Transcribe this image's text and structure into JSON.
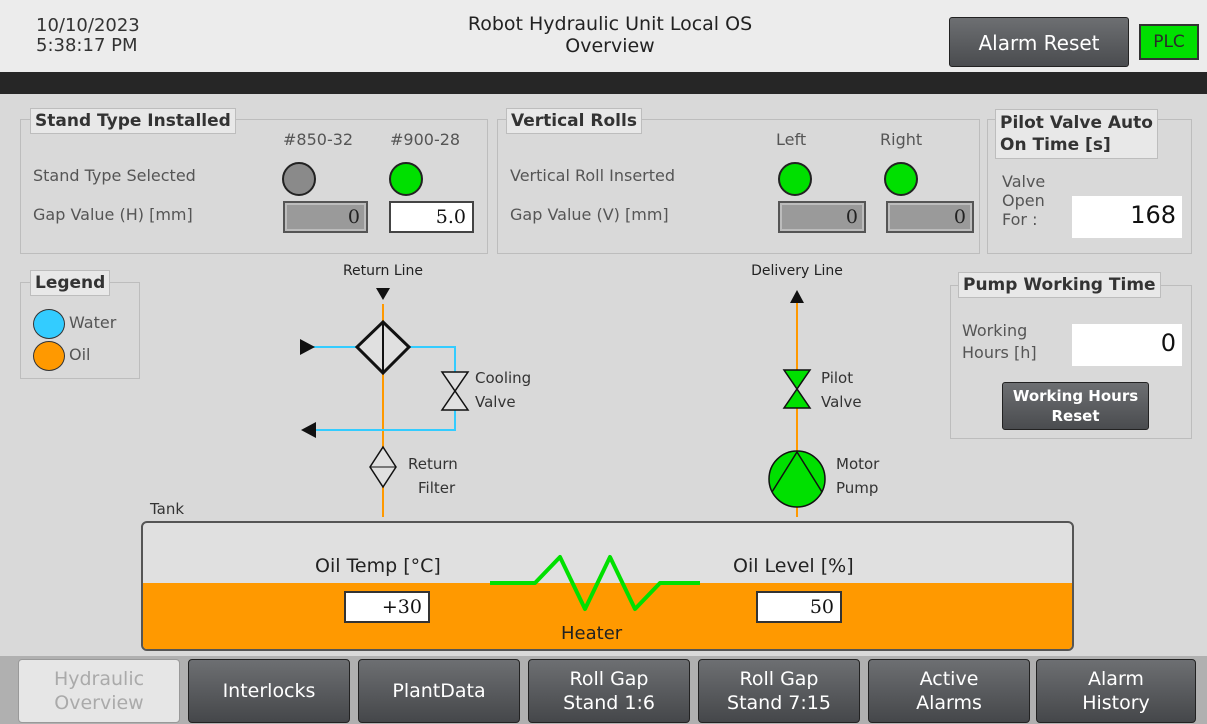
{
  "header": {
    "date": "10/10/2023",
    "time": "5:38:17 PM",
    "title_line1": "Robot Hydraulic Unit Local OS",
    "title_line2": "Overview",
    "alarm_reset_label": "Alarm Reset",
    "plc_label": "PLC"
  },
  "stand_type": {
    "title": "Stand Type Installed",
    "col1": "#850-32",
    "col2": "#900-28",
    "row1_label": "Stand Type Selected",
    "row2_label": "Gap Value (H) [mm]",
    "gap1_value": "0",
    "gap2_value": "5.0"
  },
  "vertical_rolls": {
    "title": "Vertical Rolls",
    "col1": "Left",
    "col2": "Right",
    "row1_label": "Vertical Roll Inserted",
    "row2_label": "Gap Value (V) [mm]",
    "gap1_value": "0",
    "gap2_value": "0"
  },
  "pilot_valve": {
    "title_line1": "Pilot Valve Auto",
    "title_line2": "On Time [s]",
    "label_line1": "Valve",
    "label_line2": "Open",
    "label_line3": "For :",
    "value": "168"
  },
  "pump_time": {
    "title": "Pump Working Time",
    "label_line1": "Working",
    "label_line2": "Hours [h]",
    "value": "0",
    "reset_line1": "Working Hours",
    "reset_line2": "Reset"
  },
  "legend": {
    "title": "Legend",
    "items": [
      {
        "label": "Water",
        "color": "#33ccff"
      },
      {
        "label": "Oil",
        "color": "#ff9900"
      }
    ]
  },
  "diagram": {
    "return_line": "Return Line",
    "delivery_line": "Delivery Line",
    "cooling_valve_1": "Cooling",
    "cooling_valve_2": "Valve",
    "return_filter_1": "Return",
    "return_filter_2": "Filter",
    "pilot_valve_1": "Pilot",
    "pilot_valve_2": "Valve",
    "motor_pump_1": "Motor",
    "motor_pump_2": "Pump",
    "tank": "Tank",
    "colors": {
      "water": "#33ccff",
      "oil": "#ff9900",
      "active": "#00e000"
    }
  },
  "tank": {
    "oil_temp_label": "Oil Temp [°C]",
    "oil_temp_value": "+30",
    "oil_level_label": "Oil Level [%]",
    "oil_level_value": "50",
    "heater_label": "Heater"
  },
  "nav": {
    "items": [
      {
        "label": "Hydraulic\nOverview",
        "active": true
      },
      {
        "label": "Interlocks",
        "active": false
      },
      {
        "label": "PlantData",
        "active": false
      },
      {
        "label": "Roll Gap\nStand 1:6",
        "active": false
      },
      {
        "label": "Roll Gap\nStand 7:15",
        "active": false
      },
      {
        "label": "Active\nAlarms",
        "active": false
      },
      {
        "label": "Alarm\nHistory",
        "active": false
      }
    ]
  }
}
